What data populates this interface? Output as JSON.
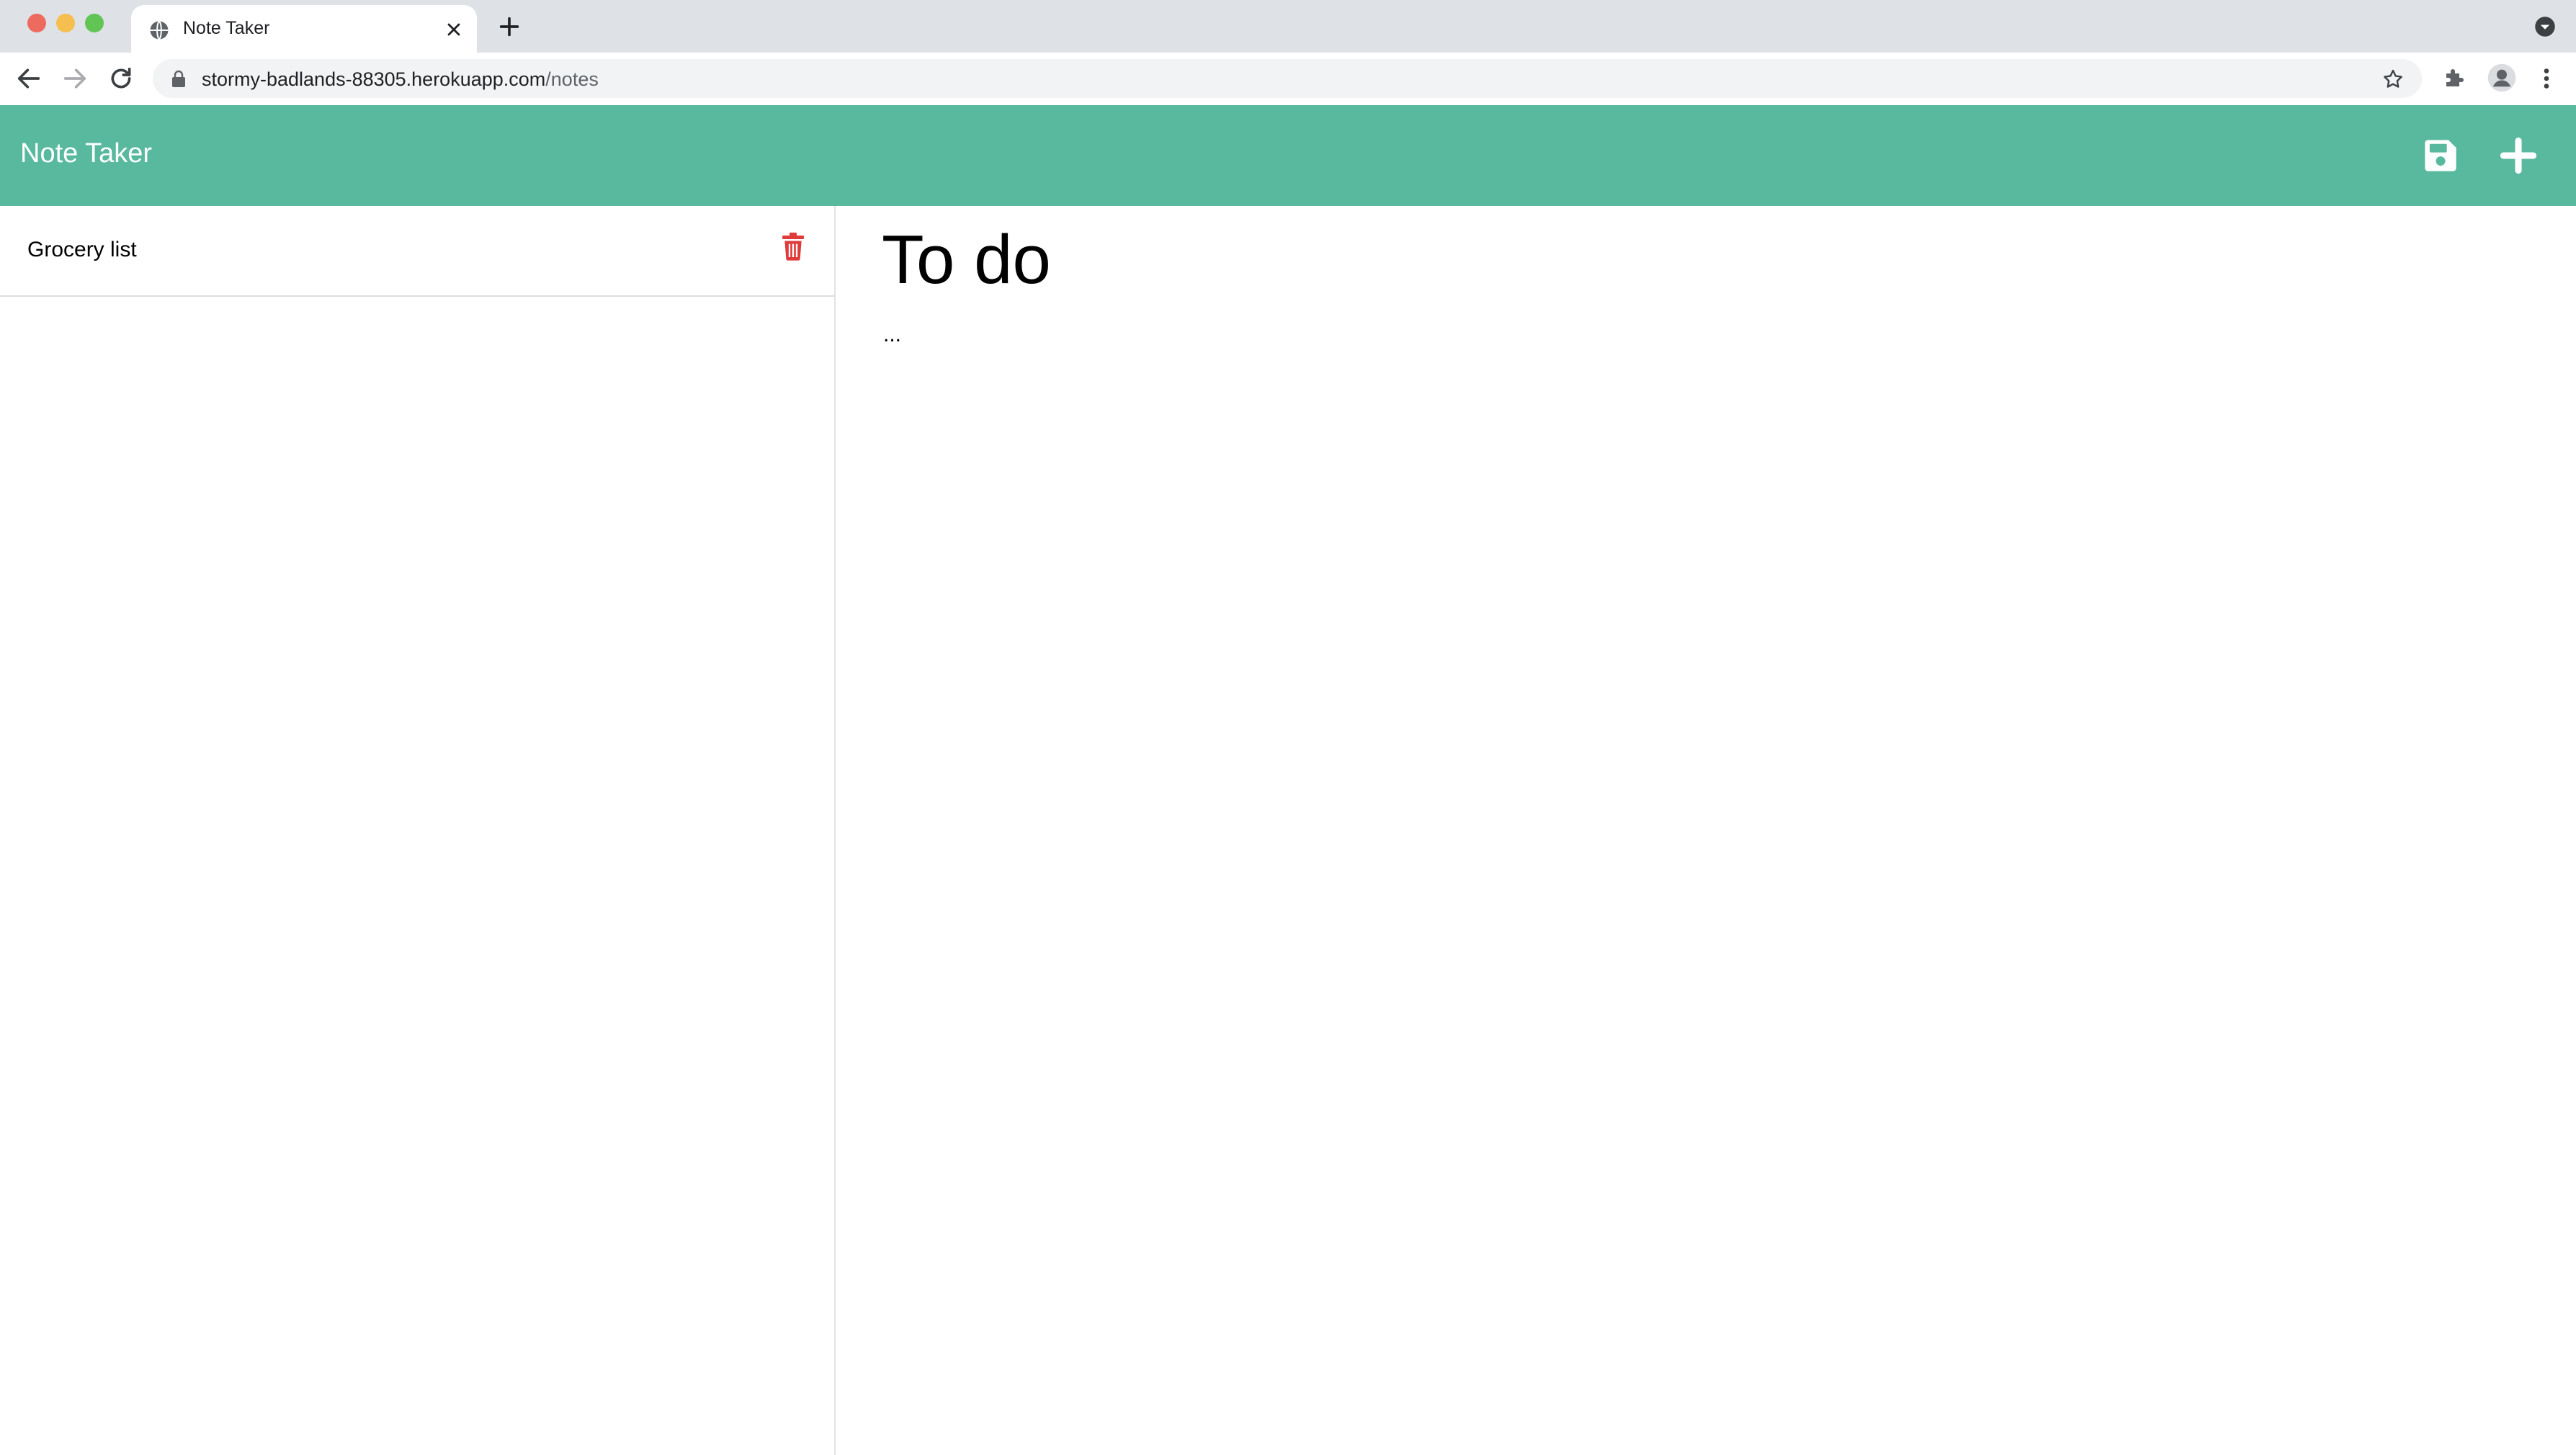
{
  "browser": {
    "tab": {
      "title": "Note Taker"
    },
    "address_bar": {
      "url_host": "stormy-badlands-88305.herokuapp.com",
      "url_path": "/notes"
    }
  },
  "app": {
    "brand": "Note Taker",
    "accent_color": "#58b99e",
    "delete_color": "#e03b3b",
    "notes": [
      {
        "title": "Grocery list"
      }
    ],
    "active_note": {
      "title": "To do",
      "text": "..."
    }
  },
  "icons": {
    "save": "floppy-disk-icon",
    "new": "plus-icon",
    "delete": "trash-icon"
  }
}
